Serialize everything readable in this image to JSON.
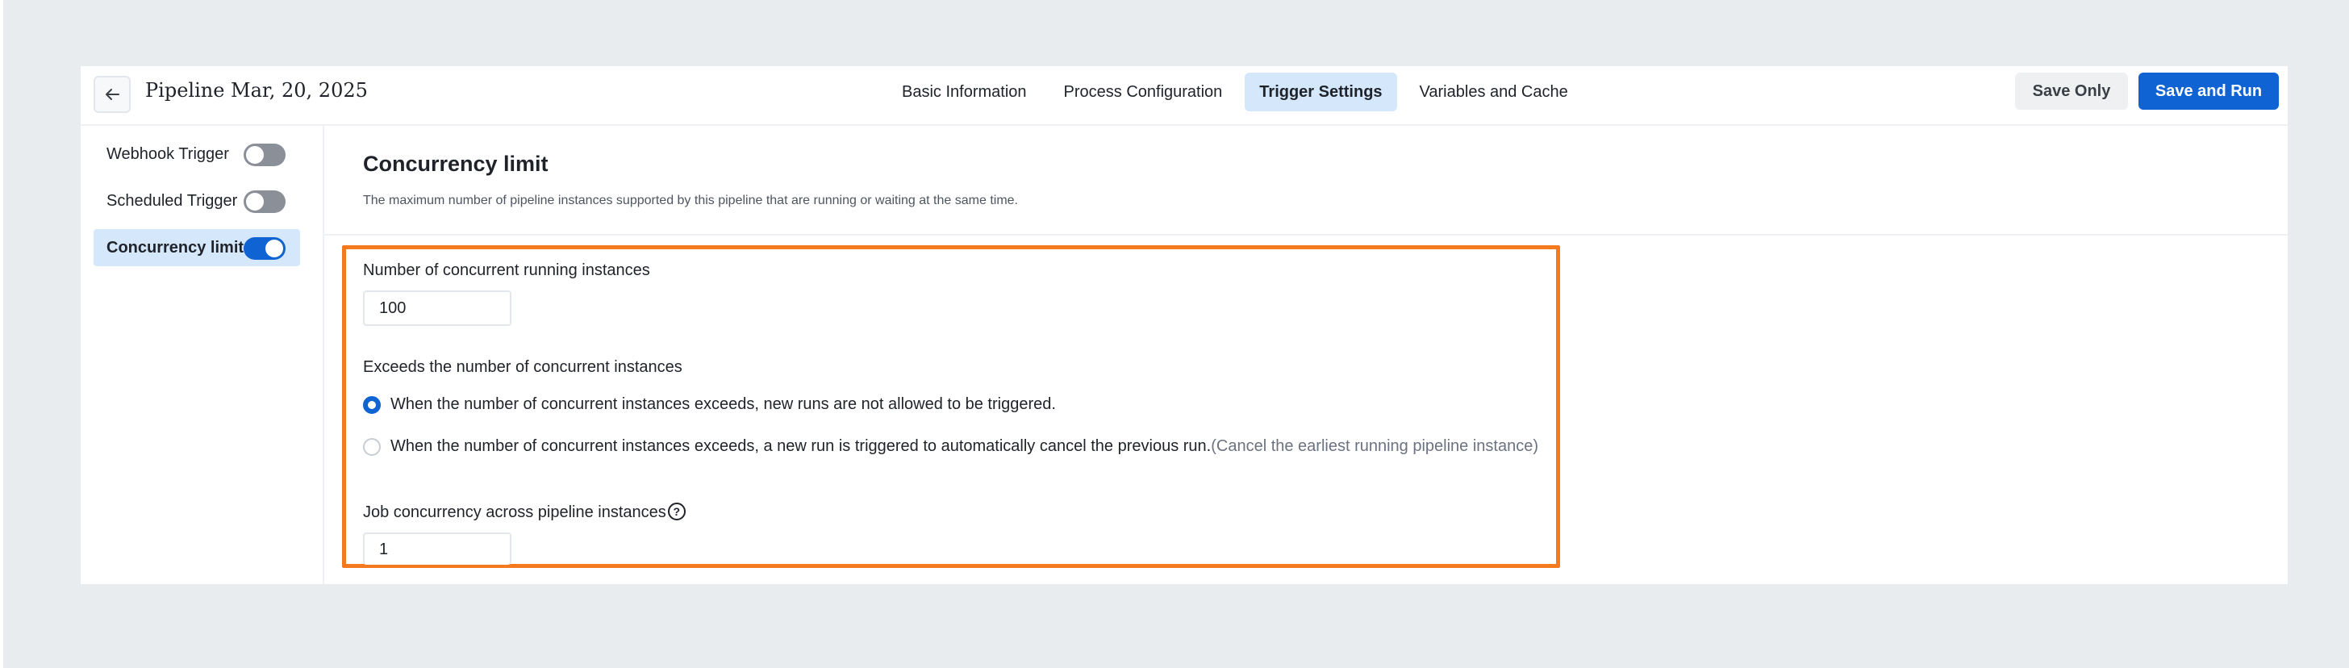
{
  "header": {
    "title": "Pipeline Mar, 20, 2025",
    "tabs": [
      {
        "label": "Basic Information",
        "active": false
      },
      {
        "label": "Process Configuration",
        "active": false
      },
      {
        "label": "Trigger Settings",
        "active": true
      },
      {
        "label": "Variables and Cache",
        "active": false
      }
    ],
    "save_only_label": "Save Only",
    "save_run_label": "Save and Run"
  },
  "sidebar": {
    "items": [
      {
        "label": "Webhook Trigger",
        "enabled": false
      },
      {
        "label": "Scheduled Trigger",
        "enabled": false
      },
      {
        "label": "Concurrency limit",
        "enabled": true
      }
    ]
  },
  "main": {
    "title": "Concurrency limit",
    "description": "The maximum number of pipeline instances supported by this pipeline that are running or waiting at the same time.",
    "concurrent_label": "Number of concurrent running instances",
    "concurrent_value": "100",
    "exceeds_label": "Exceeds the number of concurrent instances",
    "options": [
      {
        "label": "When the number of concurrent instances exceeds, new runs are not allowed to be triggered.",
        "note": "",
        "checked": true
      },
      {
        "label": "When the number of concurrent instances exceeds, a new run is triggered to automatically cancel the previous run.",
        "note": "(Cancel the earliest running pipeline instance)",
        "checked": false
      }
    ],
    "job_label": "Job concurrency across pipeline instances",
    "job_value": "1"
  },
  "colors": {
    "accent": "#0f63d2",
    "highlight": "#f47a20",
    "active_tab_bg": "#d4e7fb"
  },
  "icons": {
    "back": "arrow-left-icon",
    "help": "question-circle-icon"
  }
}
